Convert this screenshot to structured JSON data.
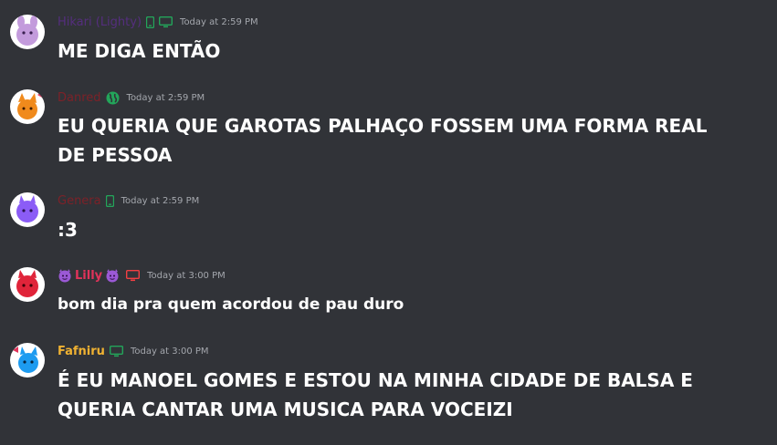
{
  "colors": {
    "background": "#313338",
    "timestamp": "#a4a7ad",
    "mobile_online": "#23a55a",
    "desktop_online": "#23a55a",
    "desktop_dnd": "#f23f43",
    "web_online": "#23a55a"
  },
  "messages": [
    {
      "author": "Hikari (Lighty)",
      "author_color": "#5b2e8a",
      "avatar_icon": "purple-rabbit-avatar",
      "status_icons": [
        "mobile-icon",
        "desktop-icon"
      ],
      "timestamp": "Today at 2:59 PM",
      "content": "ME DIGA ENTÃO"
    },
    {
      "author": "Danred",
      "author_color": "#8a1f26",
      "avatar_icon": "orange-fox-avatar",
      "status_icons": [
        "globe-icon"
      ],
      "timestamp": "Today at 2:59 PM",
      "content": "EU QUERIA QUE GAROTAS PALHAÇO FOSSEM UMA FORMA REAL DE PESSOA"
    },
    {
      "author": "Genera",
      "author_color": "#8a1f26",
      "avatar_icon": "violet-creature-avatar",
      "status_icons": [
        "mobile-icon"
      ],
      "timestamp": "Today at 2:59 PM",
      "content": ":3"
    },
    {
      "author": "Lilly",
      "author_color": "#e0335a",
      "avatar_icon": "red-creature-avatar",
      "emotes": [
        "purple-devil-emote",
        "purple-devil-emote"
      ],
      "status_icons": [
        "desktop-icon"
      ],
      "timestamp": "Today at 3:00 PM",
      "content": "bom dia pra quem acordou de pau duro"
    },
    {
      "author": "Fafniru",
      "author_color": "#f0b232",
      "avatar_icon": "blue-creature-avatar",
      "status_icons": [
        "desktop-icon"
      ],
      "timestamp": "Today at 3:00 PM",
      "content": "É EU MANOEL GOMES E ESTOU NA MINHA CIDADE DE BALSA E QUERIA CANTAR UMA MUSICA PARA VOCEIZI"
    }
  ]
}
